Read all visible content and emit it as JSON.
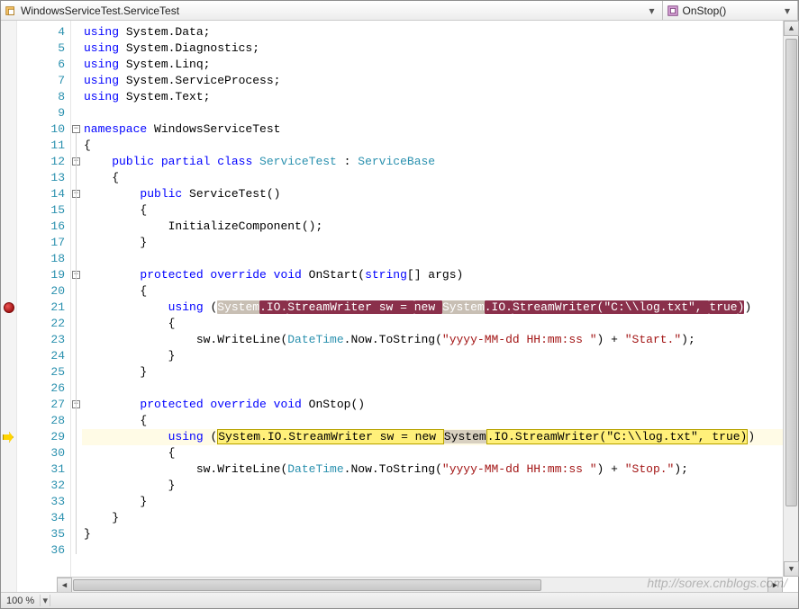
{
  "nav": {
    "class_label": "WindowsServiceTest.ServiceTest",
    "member_label": "OnStop()"
  },
  "status": {
    "zoom": "100 %"
  },
  "watermark": "http://sorex.cnblogs.com/",
  "outline": {
    "minus_glyph": "−"
  },
  "code": {
    "lines": [
      {
        "n": 4,
        "indent": 0,
        "tok": [
          {
            "t": "kw",
            "v": "using "
          },
          {
            "t": "txt",
            "v": "System.Data;"
          }
        ]
      },
      {
        "n": 5,
        "indent": 0,
        "tok": [
          {
            "t": "kw",
            "v": "using "
          },
          {
            "t": "txt",
            "v": "System.Diagnostics;"
          }
        ]
      },
      {
        "n": 6,
        "indent": 0,
        "tok": [
          {
            "t": "kw",
            "v": "using "
          },
          {
            "t": "txt",
            "v": "System.Linq;"
          }
        ]
      },
      {
        "n": 7,
        "indent": 0,
        "tok": [
          {
            "t": "kw",
            "v": "using "
          },
          {
            "t": "txt",
            "v": "System.ServiceProcess;"
          }
        ]
      },
      {
        "n": 8,
        "indent": 0,
        "tok": [
          {
            "t": "kw",
            "v": "using "
          },
          {
            "t": "txt",
            "v": "System.Text;"
          }
        ]
      },
      {
        "n": 9,
        "indent": 0,
        "tok": []
      },
      {
        "n": 10,
        "indent": 0,
        "box": true,
        "tok": [
          {
            "t": "kw",
            "v": "namespace "
          },
          {
            "t": "txt",
            "v": "WindowsServiceTest"
          }
        ]
      },
      {
        "n": 11,
        "indent": 0,
        "tok": [
          {
            "t": "txt",
            "v": "{"
          }
        ]
      },
      {
        "n": 12,
        "indent": 1,
        "box": true,
        "tok": [
          {
            "t": "kw",
            "v": "public partial class "
          },
          {
            "t": "type",
            "v": "ServiceTest"
          },
          {
            "t": "txt",
            "v": " : "
          },
          {
            "t": "type",
            "v": "ServiceBase"
          }
        ]
      },
      {
        "n": 13,
        "indent": 1,
        "tok": [
          {
            "t": "txt",
            "v": "{"
          }
        ]
      },
      {
        "n": 14,
        "indent": 2,
        "box": true,
        "tok": [
          {
            "t": "kw",
            "v": "public "
          },
          {
            "t": "txt",
            "v": "ServiceTest()"
          }
        ]
      },
      {
        "n": 15,
        "indent": 2,
        "tok": [
          {
            "t": "txt",
            "v": "{"
          }
        ]
      },
      {
        "n": 16,
        "indent": 3,
        "tok": [
          {
            "t": "txt",
            "v": "InitializeComponent();"
          }
        ]
      },
      {
        "n": 17,
        "indent": 2,
        "tok": [
          {
            "t": "txt",
            "v": "}"
          }
        ]
      },
      {
        "n": 18,
        "indent": 0,
        "tok": []
      },
      {
        "n": 19,
        "indent": 2,
        "box": true,
        "tok": [
          {
            "t": "kw",
            "v": "protected override void "
          },
          {
            "t": "txt",
            "v": "OnStart("
          },
          {
            "t": "kw",
            "v": "string"
          },
          {
            "t": "txt",
            "v": "[] args)"
          }
        ]
      },
      {
        "n": 20,
        "indent": 2,
        "tok": [
          {
            "t": "txt",
            "v": "{"
          }
        ]
      },
      {
        "n": 21,
        "indent": 3,
        "bp": "red",
        "tok": [
          {
            "t": "kw",
            "v": "using "
          },
          {
            "t": "txt",
            "v": "("
          },
          {
            "t": "hl-mute",
            "v": "System"
          },
          {
            "t": "hl-red",
            "v": ".IO."
          },
          {
            "t": "hl-red",
            "v": "StreamWriter sw = "
          },
          {
            "t": "hl-red",
            "v": "new "
          },
          {
            "t": "hl-mute",
            "v": "System"
          },
          {
            "t": "hl-red",
            "v": ".IO."
          },
          {
            "t": "hl-red",
            "v": "StreamWriter(\"C:\\\\log.txt\", "
          },
          {
            "t": "hl-red",
            "v": "true"
          },
          {
            "t": "hl-red",
            "v": ")"
          },
          {
            "t": "txt",
            "v": ")"
          }
        ]
      },
      {
        "n": 22,
        "indent": 3,
        "tok": [
          {
            "t": "txt",
            "v": "{"
          }
        ]
      },
      {
        "n": 23,
        "indent": 4,
        "tok": [
          {
            "t": "txt",
            "v": "sw.WriteLine("
          },
          {
            "t": "type",
            "v": "DateTime"
          },
          {
            "t": "txt",
            "v": ".Now.ToString("
          },
          {
            "t": "str",
            "v": "\"yyyy-MM-dd HH:mm:ss \""
          },
          {
            "t": "txt",
            "v": ") + "
          },
          {
            "t": "str",
            "v": "\"Start.\""
          },
          {
            "t": "txt",
            "v": ");"
          }
        ]
      },
      {
        "n": 24,
        "indent": 3,
        "tok": [
          {
            "t": "txt",
            "v": "}"
          }
        ]
      },
      {
        "n": 25,
        "indent": 2,
        "tok": [
          {
            "t": "txt",
            "v": "}"
          }
        ]
      },
      {
        "n": 26,
        "indent": 0,
        "tok": []
      },
      {
        "n": 27,
        "indent": 2,
        "box": true,
        "tok": [
          {
            "t": "kw",
            "v": "protected override void "
          },
          {
            "t": "txt",
            "v": "OnStop()"
          }
        ]
      },
      {
        "n": 28,
        "indent": 2,
        "tok": [
          {
            "t": "txt",
            "v": "{"
          }
        ]
      },
      {
        "n": 29,
        "indent": 3,
        "bp": "yellow",
        "current": true,
        "tok": [
          {
            "t": "kw",
            "v": "using "
          },
          {
            "t": "txt",
            "v": "("
          },
          {
            "t": "hl-yel",
            "v": "System.IO.StreamWriter sw = new "
          },
          {
            "t": "hl-ref",
            "v": "System"
          },
          {
            "t": "hl-yel",
            "v": ".IO.StreamWriter(\"C:\\\\log.txt\", true)"
          },
          {
            "t": "txt",
            "v": ")"
          }
        ]
      },
      {
        "n": 30,
        "indent": 3,
        "tok": [
          {
            "t": "txt",
            "v": "{"
          }
        ]
      },
      {
        "n": 31,
        "indent": 4,
        "tok": [
          {
            "t": "txt",
            "v": "sw.WriteLine("
          },
          {
            "t": "type",
            "v": "DateTime"
          },
          {
            "t": "txt",
            "v": ".Now.ToString("
          },
          {
            "t": "str",
            "v": "\"yyyy-MM-dd HH:mm:ss \""
          },
          {
            "t": "txt",
            "v": ") + "
          },
          {
            "t": "str",
            "v": "\"Stop.\""
          },
          {
            "t": "txt",
            "v": ");"
          }
        ]
      },
      {
        "n": 32,
        "indent": 3,
        "tok": [
          {
            "t": "txt",
            "v": "}"
          }
        ]
      },
      {
        "n": 33,
        "indent": 2,
        "tok": [
          {
            "t": "txt",
            "v": "}"
          }
        ]
      },
      {
        "n": 34,
        "indent": 1,
        "tok": [
          {
            "t": "txt",
            "v": "}"
          }
        ]
      },
      {
        "n": 35,
        "indent": 0,
        "tok": [
          {
            "t": "txt",
            "v": "}"
          }
        ]
      },
      {
        "n": 36,
        "indent": 0,
        "tok": []
      }
    ]
  }
}
